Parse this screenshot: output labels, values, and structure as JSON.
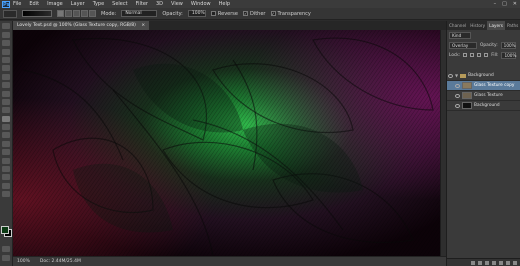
{
  "app_logo": "Ps",
  "menu": [
    "File",
    "Edit",
    "Image",
    "Layer",
    "Type",
    "Select",
    "Filter",
    "3D",
    "View",
    "Window",
    "Help"
  ],
  "window_buttons": [
    "–",
    "□",
    "✕"
  ],
  "options": {
    "mode_label": "Mode:",
    "mode_value": "Normal",
    "opacity_label": "Opacity:",
    "opacity_value": "100%",
    "reverse_label": "Reverse",
    "dither_label": "Dither",
    "transparency_label": "Transparency"
  },
  "document": {
    "tab_title": "Lovely Text.psd @ 100% (Glass Texture copy, RGB/8)",
    "close": "×"
  },
  "status": {
    "zoom": "100%",
    "doc_size": "Doc: 2.44M/25.4M"
  },
  "panel": {
    "tabs": [
      "Channel",
      "History",
      "Layers",
      "Paths"
    ],
    "active_tab": "Layers",
    "kind_label": "Kind",
    "blend_mode": "Overlay",
    "opacity_label": "Opacity:",
    "opacity_value": "100%",
    "lock_label": "Lock:",
    "fill_label": "Fill:",
    "fill_value": "100%",
    "layers": [
      {
        "name": "Background",
        "type": "group",
        "selected": false
      },
      {
        "name": "Glass Texture copy",
        "type": "layer",
        "selected": true
      },
      {
        "name": "Glass Texture",
        "type": "layer",
        "selected": false
      },
      {
        "name": "Background",
        "type": "layer",
        "selected": false
      }
    ]
  },
  "colors": {
    "foreground": "#0b3a14",
    "background": "#000000",
    "selected_layer": "#5a7a9a"
  }
}
